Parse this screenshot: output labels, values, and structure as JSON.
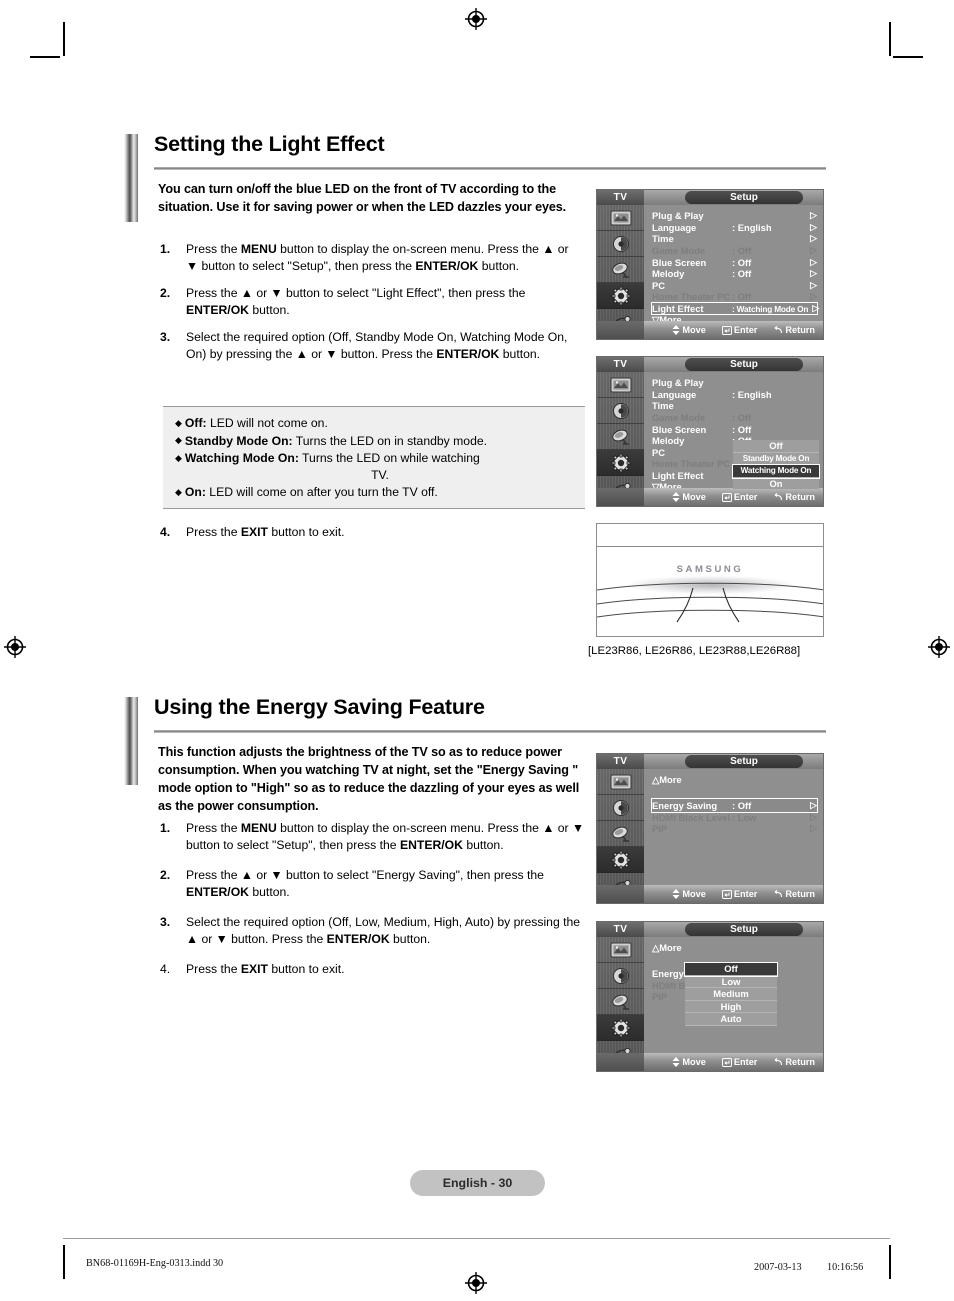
{
  "page": {
    "number_label": "English - 30"
  },
  "sections": [
    {
      "title": "Setting the Light Effect",
      "lead": "You can turn on/off the blue LED on the front of TV according to the situation. Use it for saving power or when the LED dazzles your eyes.",
      "steps": [
        {
          "num": "1.",
          "text_parts": [
            "Press the ",
            "MENU",
            " button to display the on-screen menu. Press the ▲ or ▼ button to select \"Setup\", then press the ",
            "ENTER/OK",
            " button."
          ]
        },
        {
          "num": "2.",
          "text_parts": [
            "Press the ▲ or ▼ button to select \"Light Effect\", then press the ",
            "ENTER/OK",
            " button."
          ]
        },
        {
          "num": "3.",
          "text_parts": [
            "Select the required option (Off, Standby Mode On, Watching Mode On, On) by pressing the ▲ or ▼ button. Press the ",
            "ENTER/OK",
            " button."
          ]
        },
        {
          "num": "4.",
          "text_parts": [
            "Press the ",
            "EXIT",
            " button to exit."
          ]
        }
      ],
      "notes": [
        {
          "term": "Off:",
          "desc": " LED will not come on."
        },
        {
          "term": "Standby Mode On:",
          "desc": " Turns the LED on in standby mode."
        },
        {
          "term": "Watching Mode On:",
          "desc": " Turns the LED on while watching",
          "desc2": "TV."
        },
        {
          "term": "On:",
          "desc": " LED will come on after you turn the TV off."
        }
      ]
    },
    {
      "title": "Using the Energy Saving Feature",
      "lead": "This function adjusts the brightness of the TV so as to reduce power consumption. When you watching TV at night, set the \"Energy Saving \" mode option to \"High\" so as to reduce the dazzling of your eyes as well as the power consumption.",
      "steps": [
        {
          "num": "1.",
          "text_parts": [
            "Press the ",
            "MENU",
            " button to display the on-screen menu. Press the ▲ or ▼ button to select \"Setup\", then press the ",
            "ENTER/OK",
            " button."
          ]
        },
        {
          "num": "2.",
          "text_parts": [
            "Press the ▲ or ▼ button to select \"Energy Saving\", then press the ",
            "ENTER/OK",
            " button."
          ]
        },
        {
          "num": "3.",
          "text_parts": [
            "Select the required option (Off, Low, Medium, High, Auto) by pressing the ▲ or ▼ button. Press the ",
            "ENTER/OK",
            " button."
          ]
        },
        {
          "num": "4.",
          "text_parts": [
            "Press the ",
            "EXIT",
            " button to exit."
          ]
        }
      ]
    }
  ],
  "osd_common": {
    "tv_label": "TV",
    "title": "Setup",
    "bottom": {
      "move": "Move",
      "enter": "Enter",
      "return": "Return"
    },
    "side_icons": [
      "picture-icon",
      "sound-icon",
      "channel-icon",
      "setup-icon",
      "input-icon"
    ]
  },
  "osd_menus": [
    {
      "id": "setup-light-effect-highlighted",
      "rows": [
        {
          "label": "Plug & Play",
          "value": "",
          "arrow": "▷",
          "state": "normal"
        },
        {
          "label": "Language",
          "value": ": English",
          "arrow": "▷",
          "state": "normal"
        },
        {
          "label": "Time",
          "value": "",
          "arrow": "▷",
          "state": "normal"
        },
        {
          "label": "Game Mode",
          "value": ": Off",
          "arrow": "▷",
          "state": "dim"
        },
        {
          "label": "Blue Screen",
          "value": ": Off",
          "arrow": "▷",
          "state": "normal"
        },
        {
          "label": "Melody",
          "value": ": Off",
          "arrow": "▷",
          "state": "normal"
        },
        {
          "label": "PC",
          "value": "",
          "arrow": "▷",
          "state": "normal"
        },
        {
          "label": "Home Theater PC",
          "value": ": Off",
          "arrow": "▷",
          "state": "dim"
        },
        {
          "label": "Light Effect",
          "value": ": Watching Mode On",
          "arrow": "▷",
          "state": "highlight"
        },
        {
          "label": "▽More",
          "value": "",
          "arrow": "",
          "state": "normal"
        }
      ],
      "popup": null
    },
    {
      "id": "setup-light-effect-options",
      "rows": [
        {
          "label": "Plug & Play",
          "value": "",
          "arrow": "",
          "state": "normal"
        },
        {
          "label": "Language",
          "value": ": English",
          "arrow": "",
          "state": "normal"
        },
        {
          "label": "Time",
          "value": "",
          "arrow": "",
          "state": "normal"
        },
        {
          "label": "Game Mode",
          "value": ": Off",
          "arrow": "",
          "state": "dim"
        },
        {
          "label": "Blue Screen",
          "value": ": Off",
          "arrow": "",
          "state": "normal"
        },
        {
          "label": "Melody",
          "value": ": Off",
          "arrow": "",
          "state": "normal"
        },
        {
          "label": "PC",
          "value": "",
          "arrow": "",
          "state": "normal"
        },
        {
          "label": "Home Theater PC",
          "value": ":",
          "arrow": "",
          "state": "dim"
        },
        {
          "label": "Light Effect",
          "value": ":",
          "arrow": "",
          "state": "normal"
        },
        {
          "label": "▽More",
          "value": "",
          "arrow": "",
          "state": "normal"
        }
      ],
      "popup": {
        "options": [
          "Off",
          "Standby Mode On",
          "Watching Mode On",
          "On"
        ],
        "selected_index": 2,
        "small_indices": [
          1,
          2
        ]
      }
    },
    {
      "id": "setup-energy-saving-highlighted",
      "rows": [
        {
          "label": "△More",
          "value": "",
          "arrow": "",
          "state": "normal"
        },
        {
          "label": "",
          "value": "",
          "arrow": "",
          "state": "spacer"
        },
        {
          "label": "Energy Saving",
          "value": ": Off",
          "arrow": "▷",
          "state": "highlight"
        },
        {
          "label": "HDMI Black Level",
          "value": ": Low",
          "arrow": "▷",
          "state": "dim"
        },
        {
          "label": "PIP",
          "value": "",
          "arrow": "▷",
          "state": "dim"
        }
      ],
      "popup": null
    },
    {
      "id": "setup-energy-saving-options",
      "rows": [
        {
          "label": "△More",
          "value": "",
          "arrow": "",
          "state": "normal"
        },
        {
          "label": "",
          "value": "",
          "arrow": "",
          "state": "spacer"
        },
        {
          "label": "Energy Saving",
          "value": ":",
          "arrow": "",
          "state": "normal"
        },
        {
          "label": "HDMI Black Level",
          "value": ":",
          "arrow": "",
          "state": "dim"
        },
        {
          "label": "PIP",
          "value": "",
          "arrow": "",
          "state": "dim"
        }
      ],
      "popup": {
        "options": [
          "Off",
          "Low",
          "Medium",
          "High",
          "Auto"
        ],
        "selected_index": 0,
        "small_indices": []
      }
    }
  ],
  "tv_photo": {
    "brand": "SAMSUNG",
    "caption": "[LE23R86, LE26R86, LE23R88,LE26R88]"
  },
  "print_footer": {
    "left": "BN68-01169H-Eng-0313.indd   30",
    "right": "2007-03-13   　　 10:16:56"
  }
}
